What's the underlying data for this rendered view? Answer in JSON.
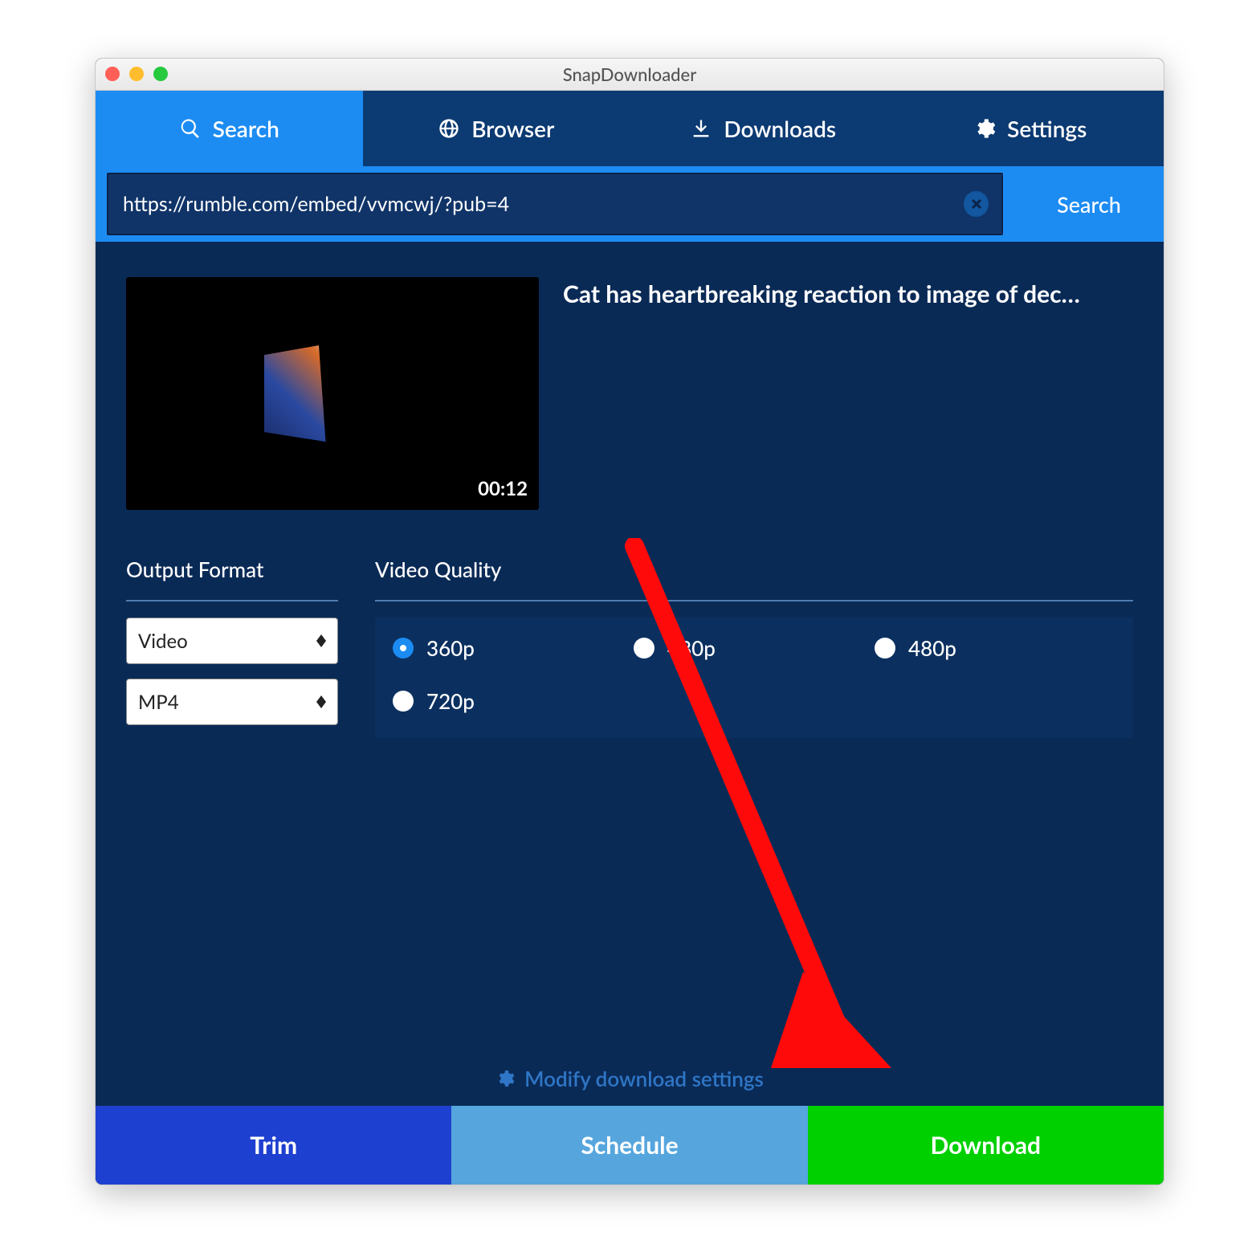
{
  "window": {
    "title": "SnapDownloader"
  },
  "tabs": {
    "search": "Search",
    "browser": "Browser",
    "downloads": "Downloads",
    "settings": "Settings"
  },
  "search": {
    "url_value": "https://rumble.com/embed/vvmcwj/?pub=4",
    "button_label": "Search"
  },
  "video": {
    "title": "Cat has heartbreaking reaction to image of dec…",
    "duration": "00:12"
  },
  "output_format": {
    "label": "Output Format",
    "type_value": "Video",
    "container_value": "MP4"
  },
  "video_quality": {
    "label": "Video Quality",
    "options": [
      {
        "label": "360p",
        "checked": true
      },
      {
        "label": "480p",
        "checked": false
      },
      {
        "label": "480p",
        "checked": false
      },
      {
        "label": "720p",
        "checked": false
      }
    ]
  },
  "modify_link": "Modify download settings",
  "actions": {
    "trim": "Trim",
    "schedule": "Schedule",
    "download": "Download"
  }
}
